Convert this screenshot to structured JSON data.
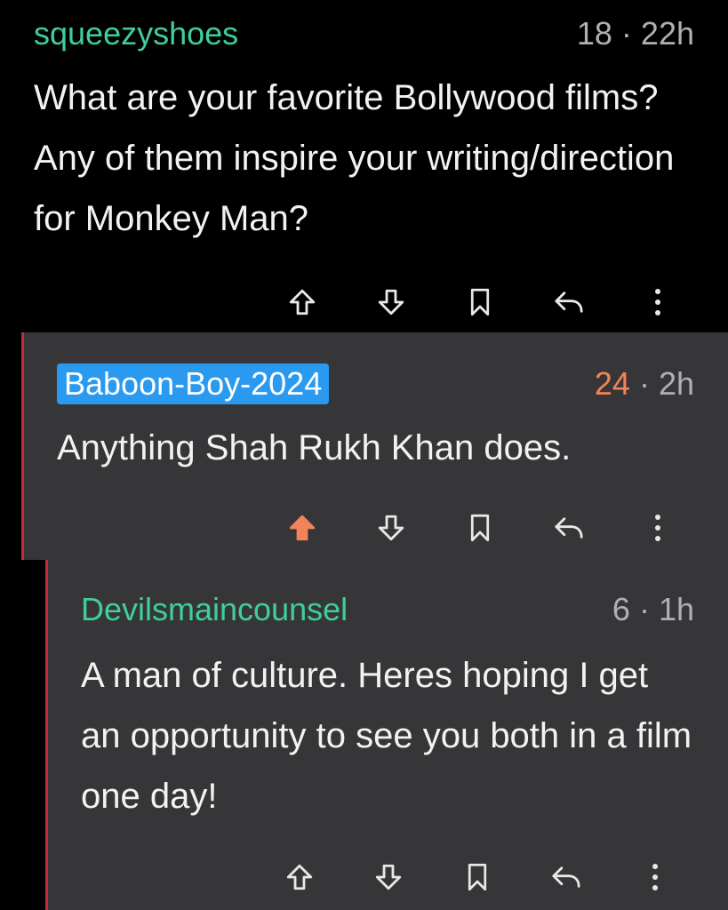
{
  "comments": [
    {
      "username": "squeezyshoes",
      "score": "18",
      "separator": "·",
      "age": "22h",
      "body": "What are your favorite Bollywood films? Any of them inspire your writing/direction for Monkey Man?"
    },
    {
      "username": "Baboon-Boy-2024",
      "score": "24",
      "separator": "·",
      "age": "2h",
      "body": "Anything Shah Rukh Khan does.",
      "upvoted": true
    },
    {
      "username": "Devilsmaincounsel",
      "score": "6",
      "separator": "·",
      "age": "1h",
      "body": "A man of culture. Heres hoping I get an opportunity to see you both in a film one day!"
    }
  ],
  "colors": {
    "username": "#3ecf9a",
    "op_badge": "#2a9af0",
    "upvote_active": "#f4825a",
    "thread_line": "#c8283a",
    "reply_bg": "#363638"
  },
  "icons": [
    "upvote-icon",
    "downvote-icon",
    "bookmark-icon",
    "reply-icon",
    "more-icon"
  ]
}
